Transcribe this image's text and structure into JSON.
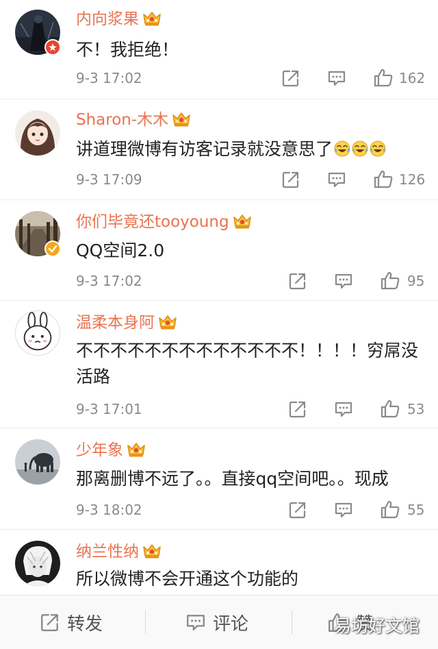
{
  "comments": [
    {
      "username": "内向浆果",
      "text": "不！我拒绝！",
      "time": "9-3 17:02",
      "likes": "162"
    },
    {
      "username": "Sharon-木木",
      "text": "讲道理微博有访客记录就没意思了",
      "time": "9-3 17:09",
      "likes": "126"
    },
    {
      "username": "你们毕竟还tooyoung",
      "text": "QQ空间2.0",
      "time": "9-3 17:02",
      "likes": "95"
    },
    {
      "username": "温柔本身阿",
      "text": "不不不不不不不不不不不不不！！！！穷屌没活路",
      "time": "9-3 17:01",
      "likes": "53"
    },
    {
      "username": "少年象",
      "text": "那离删博不远了。。直接qq空间吧。。现成",
      "time": "9-3 18:02",
      "likes": "55"
    },
    {
      "username": "纳兰性纳",
      "text": "所以微博不会开通这个功能的"
    }
  ],
  "bottom_bar": {
    "repost": "转发",
    "comment": "评论",
    "like": "赞"
  },
  "watermark": "易坊好文馆",
  "colors": {
    "username": "#eb7350",
    "meta": "#8a8a8a",
    "text": "#222222",
    "badge_red": "#e6452f",
    "badge_gold": "#f2a71c"
  },
  "icons": [
    "vip-crown-icon",
    "share-icon",
    "comment-icon",
    "like-icon",
    "laugh-cry-emoji"
  ]
}
